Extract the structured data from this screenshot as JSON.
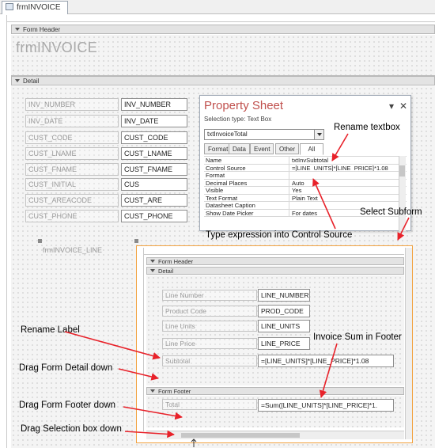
{
  "tab": {
    "label": "frmINVOICE"
  },
  "form": {
    "header_section": "Form Header",
    "header_title": "frmINVOICE",
    "detail_section": "Detail",
    "fields": [
      {
        "label": "INV_NUMBER",
        "control": "INV_NUMBER"
      },
      {
        "label": "INV_DATE",
        "control": "INV_DATE"
      },
      {
        "label": "CUST_CODE",
        "control": "CUST_CODE"
      },
      {
        "label": "CUST_LNAME",
        "control": "CUST_LNAME"
      },
      {
        "label": "CUST_FNAME",
        "control": "CUST_FNAME"
      },
      {
        "label": "CUST_INITIAL",
        "control": "CUS"
      },
      {
        "label": "CUST_AREACODE",
        "control": "CUST_ARE"
      },
      {
        "label": "CUST_PHONE",
        "control": "CUST_PHONE"
      }
    ],
    "subform_label": "frmINVOICE_LINE"
  },
  "property_sheet": {
    "title": "Property Sheet",
    "selection_type": "Selection type:  Text Box",
    "selected_object": "txtInvoiceTotal",
    "tabs": [
      "Format",
      "Data",
      "Event",
      "Other",
      "All"
    ],
    "active_tab": "All",
    "rows": [
      {
        "name": "Name",
        "value": "txtInvSubtotal"
      },
      {
        "name": "Control Source",
        "value": "=[LINE_UNITS]*[LINE_PRICE]*1.08"
      },
      {
        "name": "Format",
        "value": ""
      },
      {
        "name": "Decimal Places",
        "value": "Auto"
      },
      {
        "name": "Visible",
        "value": "Yes"
      },
      {
        "name": "Text Format",
        "value": "Plain Text"
      },
      {
        "name": "Datasheet Caption",
        "value": ""
      },
      {
        "name": "Show Date Picker",
        "value": "For dates"
      }
    ]
  },
  "subform": {
    "header_section": "Form Header",
    "detail_section": "Detail",
    "footer_section": "Form Footer",
    "fields": [
      {
        "label": "Line Number",
        "control": "LINE_NUMBER"
      },
      {
        "label": "Product Code",
        "control": "PROD_CODE"
      },
      {
        "label": "Line Units",
        "control": "LINE_UNITS"
      },
      {
        "label": "Line Price",
        "control": "LINE_PRICE"
      },
      {
        "label": "Subtotal",
        "control": "=[LINE_UNITS]*[LINE_PRICE]*1.08"
      }
    ],
    "footer_field": {
      "label": "Total",
      "control": "=Sum([LINE_UNITS]*[LINE_PRICE]*1."
    }
  },
  "annotations": {
    "rename_textbox": "Rename textbox",
    "select_subform": "Select Subform",
    "type_expression": "Type expression into Control Source",
    "rename_label": "Rename Label",
    "invoice_sum": "Invoice Sum in Footer",
    "drag_detail": "Drag Form Detail down",
    "drag_footer": "Drag Form Footer down",
    "drag_selection": "Drag Selection box down"
  },
  "colors": {
    "accent_title": "#c0504d",
    "subform_border": "#f2a341",
    "arrow": "#e8222a"
  }
}
